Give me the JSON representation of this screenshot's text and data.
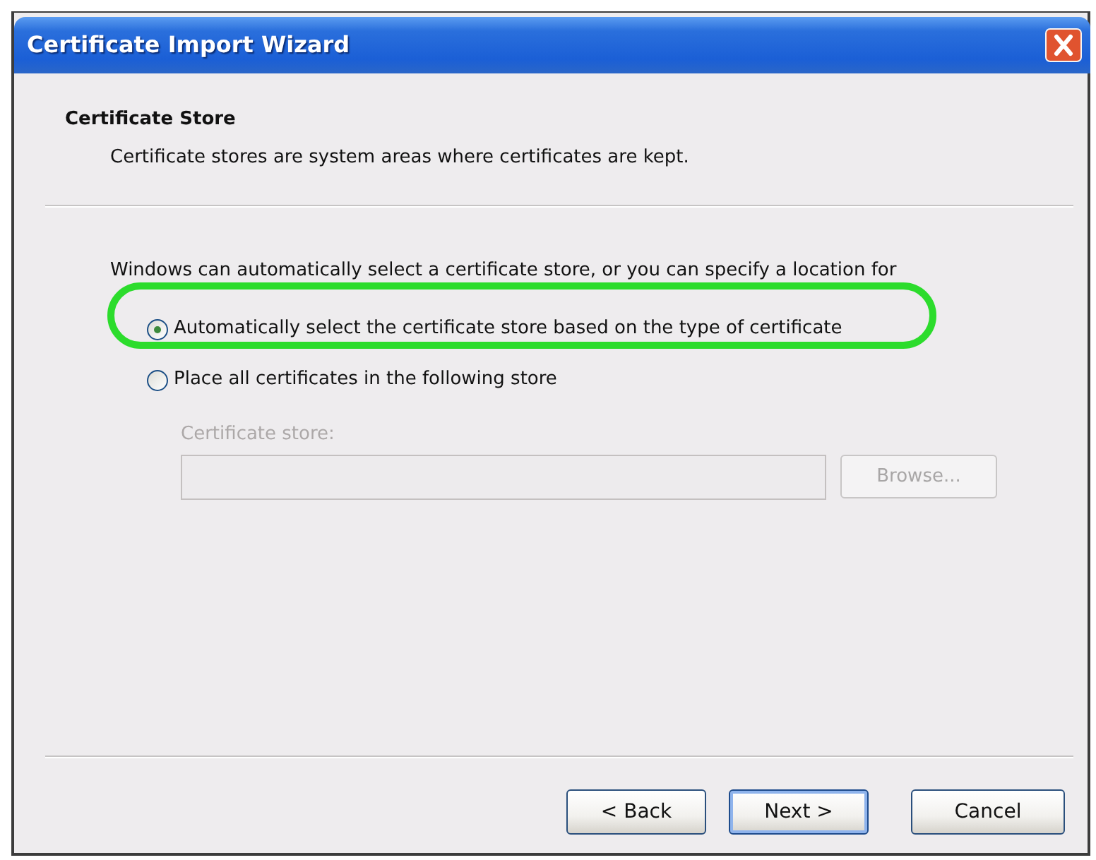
{
  "window": {
    "title": "Certificate Import Wizard"
  },
  "header": {
    "title": "Certificate Store",
    "description": "Certificate stores are system areas where certificates are kept."
  },
  "body": {
    "intro": "Windows can automatically select a certificate store, or you can specify a location for",
    "options": [
      {
        "label": "Automatically select the certificate store based on the type of certificate",
        "selected": true,
        "highlighted": true
      },
      {
        "label": "Place all certificates in the following store",
        "selected": false,
        "highlighted": false
      }
    ],
    "store": {
      "label": "Certificate store:",
      "disabled": true,
      "browse": "Browse..."
    }
  },
  "buttons": [
    {
      "label": "< Back",
      "default": false
    },
    {
      "label": "Next >",
      "default": true
    },
    {
      "label": "Cancel",
      "default": false
    }
  ]
}
